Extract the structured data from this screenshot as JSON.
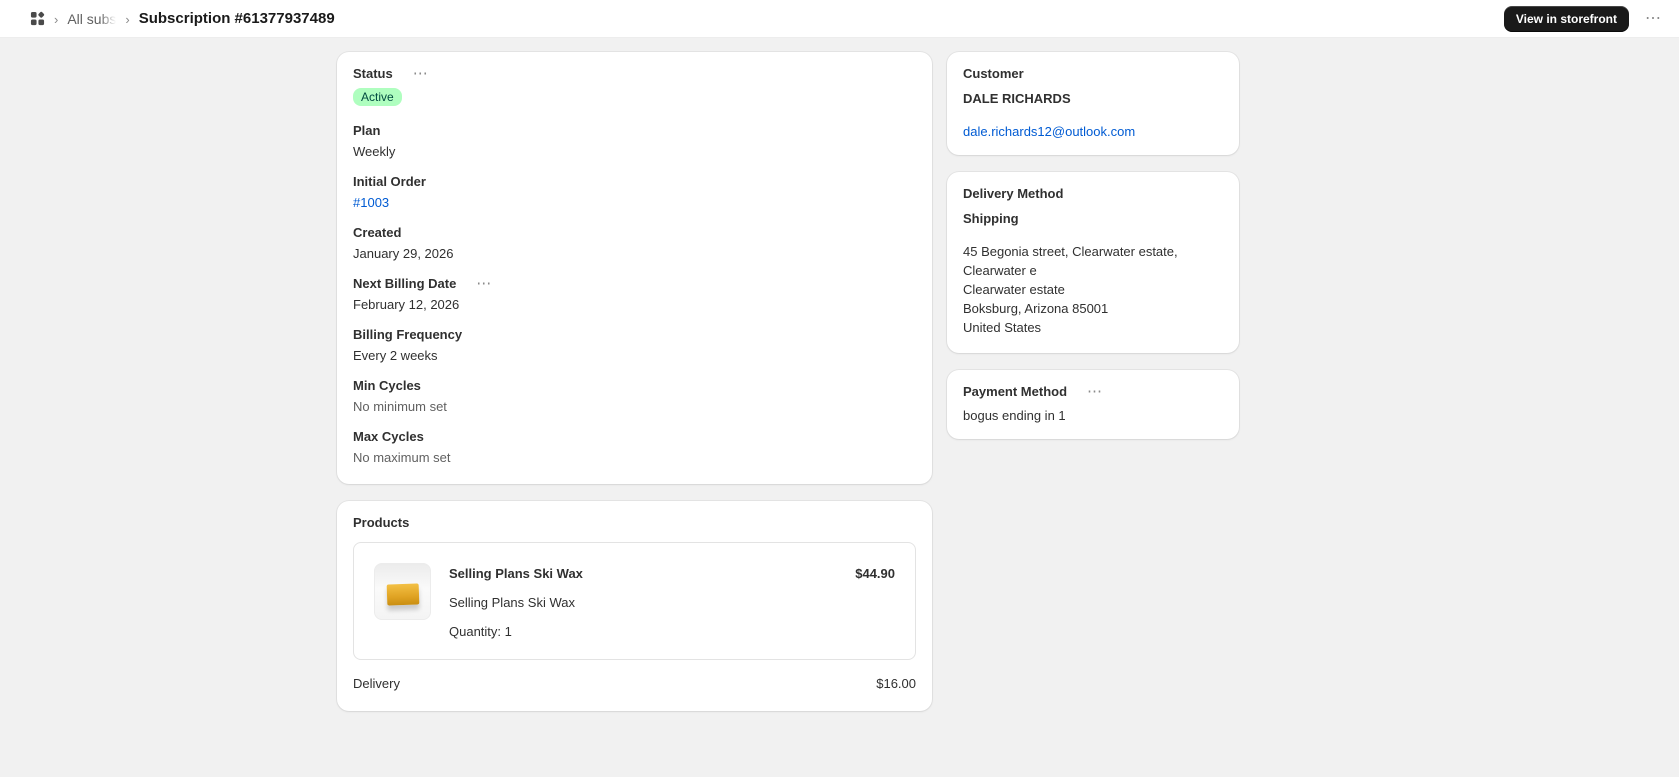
{
  "colors": {
    "background": "#f1f1f1",
    "card": "#ffffff",
    "badge_green_bg": "#affebf",
    "badge_green_text": "#014b40",
    "link_blue": "#005bd3",
    "primary_button_bg": "#1a1a1a",
    "muted_text": "#616161"
  },
  "icons": {
    "chevron_separator": "›",
    "more_horizontal": "⋯",
    "apps_grid": "apps-grid-icon"
  },
  "header": {
    "breadcrumb_root": "All subs",
    "title": "Subscription #61377937489",
    "storefront_button": "View in storefront"
  },
  "status_card": {
    "status_label": "Status",
    "status_badge": "Active",
    "plan_label": "Plan",
    "plan_value": "Weekly",
    "initial_order_label": "Initial Order",
    "initial_order_value": "#1003",
    "created_label": "Created",
    "created_value": "January 29, 2026",
    "next_billing_label": "Next Billing Date",
    "next_billing_value": "February 12, 2026",
    "billing_frequency_label": "Billing Frequency",
    "billing_frequency_value": "Every 2 weeks",
    "min_cycles_label": "Min Cycles",
    "min_cycles_value": "No minimum set",
    "max_cycles_label": "Max Cycles",
    "max_cycles_value": "No maximum set"
  },
  "products_card": {
    "title": "Products",
    "product": {
      "name": "Selling Plans Ski Wax",
      "price": "$44.90",
      "subtitle": "Selling Plans Ski Wax",
      "quantity": "Quantity: 1"
    },
    "delivery_label": "Delivery",
    "delivery_price": "$16.00"
  },
  "customer_card": {
    "title": "Customer",
    "name": "DALE RICHARDS",
    "email": "dale.richards12@outlook.com"
  },
  "delivery_card": {
    "title": "Delivery Method",
    "method": "Shipping",
    "address_lines": [
      "45 Begonia street, Clearwater estate, Clearwater e",
      "Clearwater estate",
      "Boksburg, Arizona 85001",
      "United States"
    ]
  },
  "payment_card": {
    "title": "Payment Method",
    "value": "bogus ending in 1"
  }
}
